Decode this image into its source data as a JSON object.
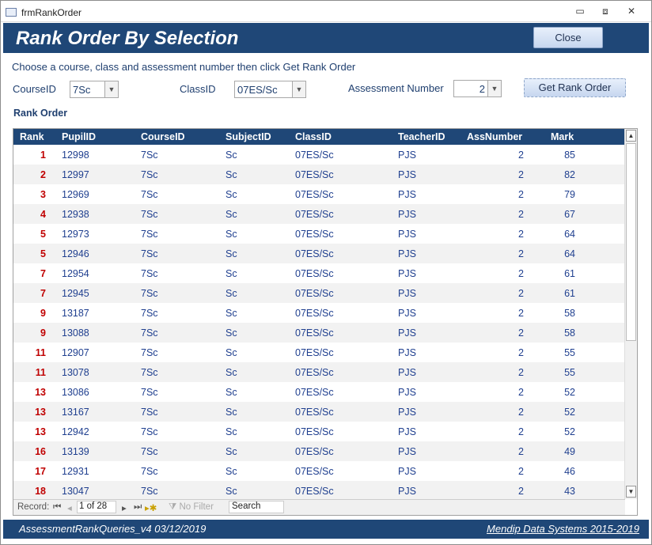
{
  "window": {
    "title": "frmRankOrder",
    "minimize": "▭",
    "restore": "⧈",
    "close": "✕"
  },
  "header": {
    "title": "Rank Order By Selection",
    "close_label": "Close"
  },
  "instructions": "Choose a course, class and assessment number then click Get Rank Order",
  "filters": {
    "course_label": "CourseID",
    "course_value": "7Sc",
    "class_label": "ClassID",
    "class_value": "07ES/Sc",
    "assessment_label": "Assessment Number",
    "assessment_value": "2",
    "get_button": "Get Rank Order"
  },
  "section_label": "Rank Order",
  "columns": [
    "Rank",
    "PupilID",
    "CourseID",
    "SubjectID",
    "ClassID",
    "TeacherID",
    "AssNumber",
    "Mark"
  ],
  "rows": [
    [
      "1",
      "12998",
      "7Sc",
      "Sc",
      "07ES/Sc",
      "PJS",
      "2",
      "85"
    ],
    [
      "2",
      "12997",
      "7Sc",
      "Sc",
      "07ES/Sc",
      "PJS",
      "2",
      "82"
    ],
    [
      "3",
      "12969",
      "7Sc",
      "Sc",
      "07ES/Sc",
      "PJS",
      "2",
      "79"
    ],
    [
      "4",
      "12938",
      "7Sc",
      "Sc",
      "07ES/Sc",
      "PJS",
      "2",
      "67"
    ],
    [
      "5",
      "12973",
      "7Sc",
      "Sc",
      "07ES/Sc",
      "PJS",
      "2",
      "64"
    ],
    [
      "5",
      "12946",
      "7Sc",
      "Sc",
      "07ES/Sc",
      "PJS",
      "2",
      "64"
    ],
    [
      "7",
      "12954",
      "7Sc",
      "Sc",
      "07ES/Sc",
      "PJS",
      "2",
      "61"
    ],
    [
      "7",
      "12945",
      "7Sc",
      "Sc",
      "07ES/Sc",
      "PJS",
      "2",
      "61"
    ],
    [
      "9",
      "13187",
      "7Sc",
      "Sc",
      "07ES/Sc",
      "PJS",
      "2",
      "58"
    ],
    [
      "9",
      "13088",
      "7Sc",
      "Sc",
      "07ES/Sc",
      "PJS",
      "2",
      "58"
    ],
    [
      "11",
      "12907",
      "7Sc",
      "Sc",
      "07ES/Sc",
      "PJS",
      "2",
      "55"
    ],
    [
      "11",
      "13078",
      "7Sc",
      "Sc",
      "07ES/Sc",
      "PJS",
      "2",
      "55"
    ],
    [
      "13",
      "13086",
      "7Sc",
      "Sc",
      "07ES/Sc",
      "PJS",
      "2",
      "52"
    ],
    [
      "13",
      "13167",
      "7Sc",
      "Sc",
      "07ES/Sc",
      "PJS",
      "2",
      "52"
    ],
    [
      "13",
      "12942",
      "7Sc",
      "Sc",
      "07ES/Sc",
      "PJS",
      "2",
      "52"
    ],
    [
      "16",
      "13139",
      "7Sc",
      "Sc",
      "07ES/Sc",
      "PJS",
      "2",
      "49"
    ],
    [
      "17",
      "12931",
      "7Sc",
      "Sc",
      "07ES/Sc",
      "PJS",
      "2",
      "46"
    ],
    [
      "18",
      "13047",
      "7Sc",
      "Sc",
      "07ES/Sc",
      "PJS",
      "2",
      "43"
    ]
  ],
  "navigator": {
    "record_label": "Record:",
    "position": "1 of 28",
    "filter_label": "No Filter",
    "search_placeholder": "Search"
  },
  "footer": {
    "left": "AssessmentRankQueries_v4  03/12/2019",
    "right": "Mendip Data Systems 2015-2019"
  }
}
